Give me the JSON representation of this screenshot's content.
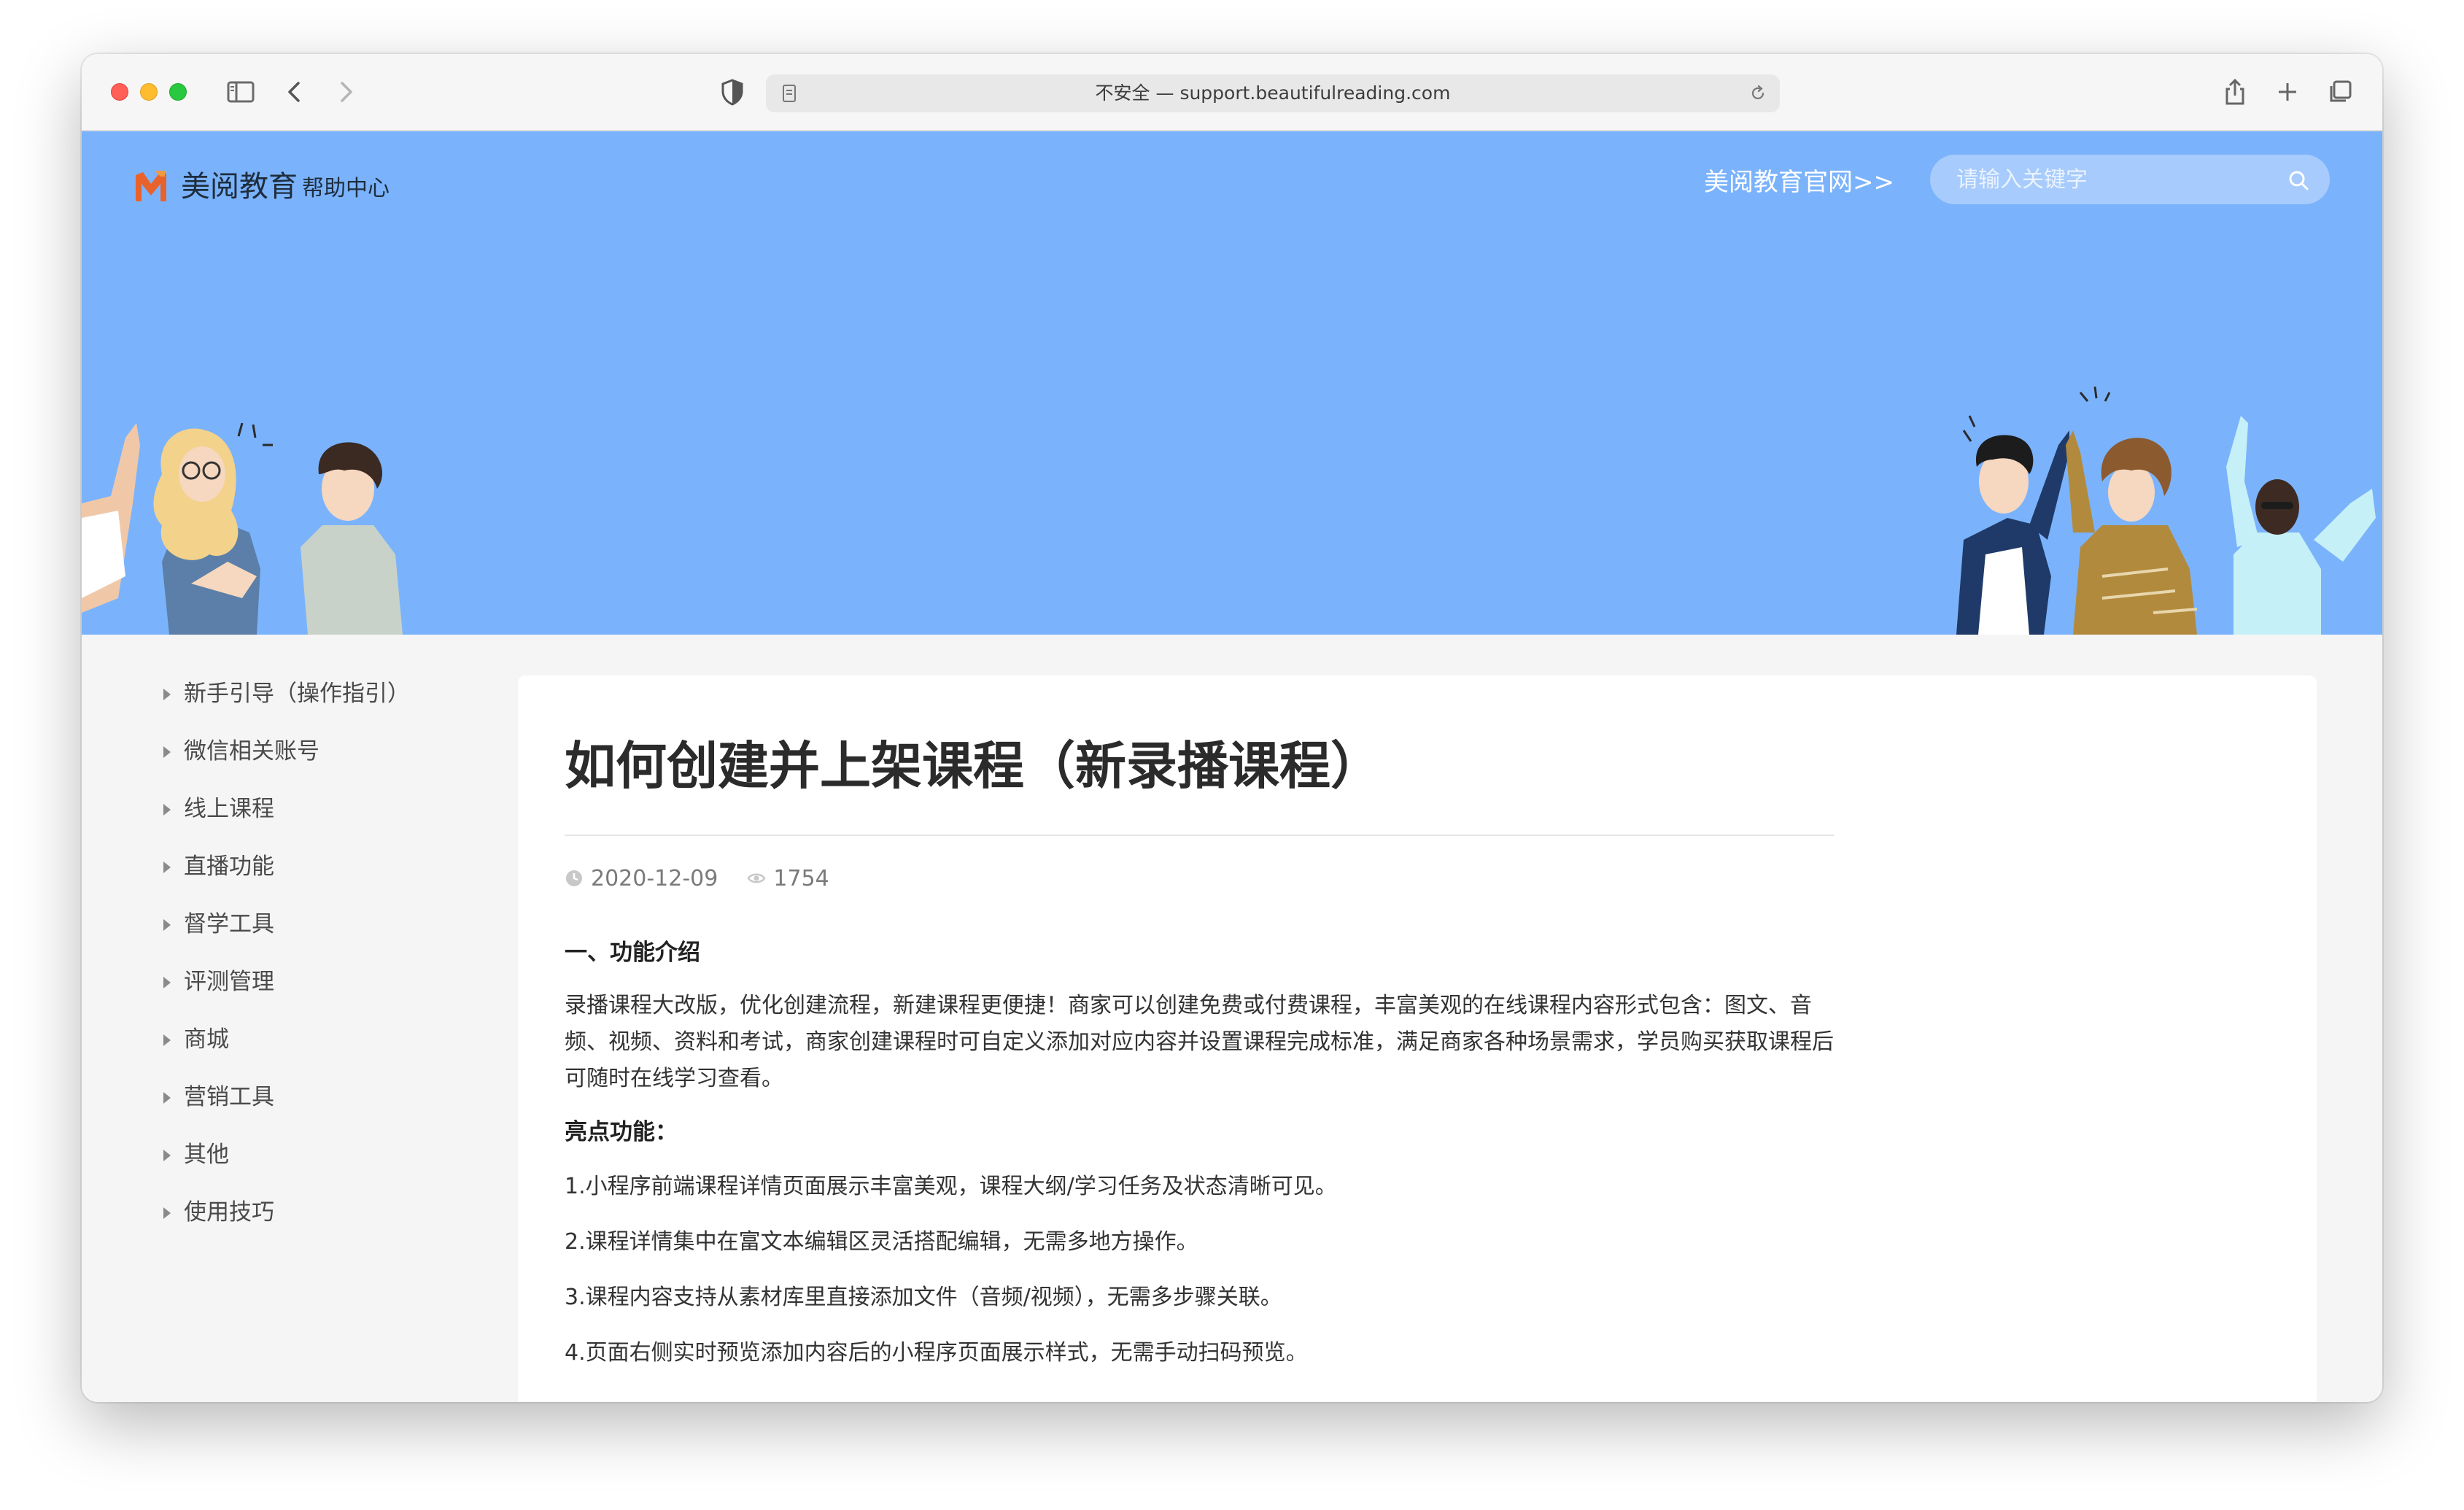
{
  "browser": {
    "url": "不安全 — support.beautifulreading.com"
  },
  "header": {
    "logo_main": "美阅教育",
    "logo_sub": "帮助中心",
    "site_link": "美阅教育官网>>",
    "search_placeholder": "请输入关键字"
  },
  "sidebar": {
    "items": [
      {
        "label": "新手引导（操作指引）"
      },
      {
        "label": "微信相关账号"
      },
      {
        "label": "线上课程"
      },
      {
        "label": "直播功能"
      },
      {
        "label": "督学工具"
      },
      {
        "label": "评测管理"
      },
      {
        "label": "商城"
      },
      {
        "label": "营销工具"
      },
      {
        "label": "其他"
      },
      {
        "label": "使用技巧"
      }
    ]
  },
  "article": {
    "title": "如何创建并上架课程（新录播课程）",
    "date": "2020-12-09",
    "views": "1754",
    "section1_heading": "一、功能介绍",
    "intro": "录播课程大改版，优化创建流程，新建课程更便捷！商家可以创建免费或付费课程，丰富美观的在线课程内容形式包含：图文、音频、视频、资料和考试，商家创建课程时可自定义添加对应内容并设置课程完成标准，满足商家各种场景需求，学员购买获取课程后可随时在线学习查看。",
    "highlights_heading": "亮点功能：",
    "highlights": [
      "1.小程序前端课程详情页面展示丰富美观，课程大纲/学习任务及状态清晰可见。",
      "2.课程详情集中在富文本编辑区灵活搭配编辑，无需多地方操作。",
      "3.课程内容支持从素材库里直接添加文件（音频/视频），无需多步骤关联。",
      "4.页面右侧实时预览添加内容后的小程序页面展示样式，无需手动扫码预览。"
    ]
  },
  "colors": {
    "banner": "#7ab3fc",
    "accent_logo": "#e8622c"
  }
}
